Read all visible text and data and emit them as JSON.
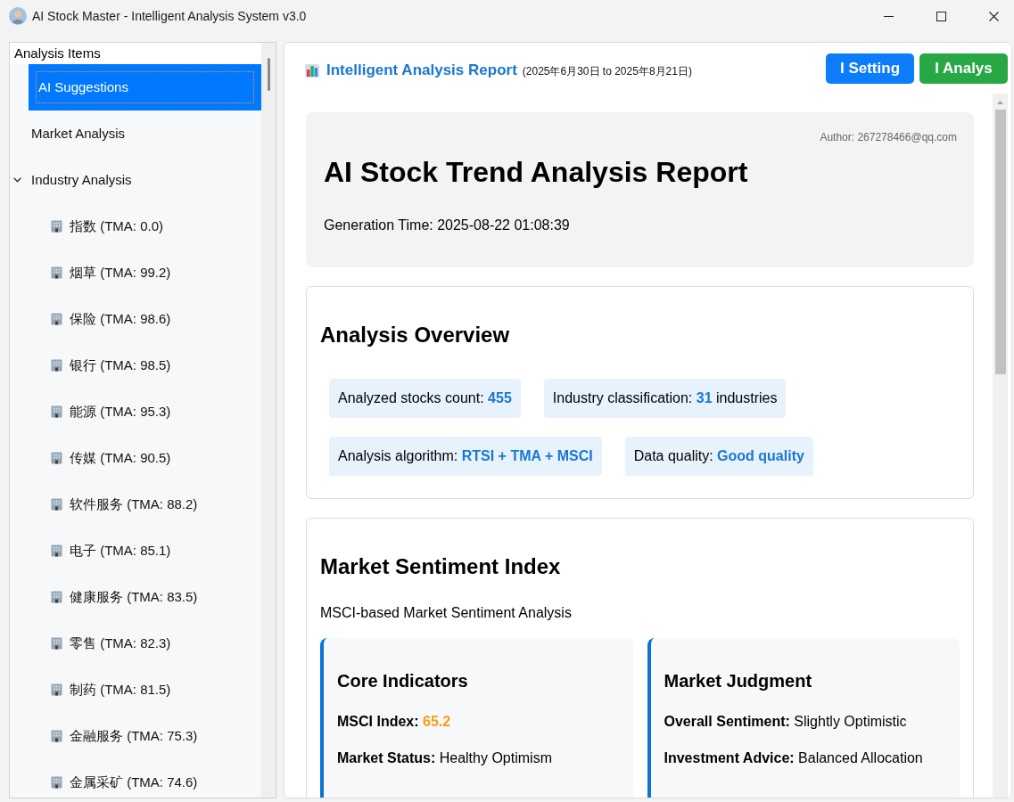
{
  "window": {
    "title": "AI Stock Master - Intelligent Analysis System v3.0"
  },
  "sidebar": {
    "header": "Analysis Items",
    "items": [
      {
        "label": "AI Suggestions",
        "selected": true
      },
      {
        "label": "Market Analysis",
        "selected": false
      },
      {
        "label": "Industry Analysis",
        "selected": false,
        "expanded": true,
        "children": [
          {
            "label": "指数 (TMA: 0.0)",
            "selected": false
          },
          {
            "label": "烟草 (TMA: 99.2)",
            "selected": false
          },
          {
            "label": "保险 (TMA: 98.6)",
            "selected": false
          },
          {
            "label": "银行 (TMA: 98.5)",
            "selected": false
          },
          {
            "label": "能源 (TMA: 95.3)",
            "selected": false
          },
          {
            "label": "传媒 (TMA: 90.5)",
            "selected": false
          },
          {
            "label": "软件服务 (TMA: 88.2)",
            "selected": false
          },
          {
            "label": "电子 (TMA: 85.1)",
            "selected": false
          },
          {
            "label": "健康服务 (TMA: 83.5)",
            "selected": false
          },
          {
            "label": "零售 (TMA: 82.3)",
            "selected": false
          },
          {
            "label": "制药 (TMA: 81.5)",
            "selected": false
          },
          {
            "label": "金融服务 (TMA: 75.3)",
            "selected": false
          },
          {
            "label": "金属采矿 (TMA: 74.6)",
            "selected": false
          }
        ]
      }
    ]
  },
  "report": {
    "title": "Intelligent Analysis Report",
    "date_range": "(2025年6月30日 to 2025年8月21日)",
    "buttons": [
      {
        "label": "I Setting",
        "kind": "primary"
      },
      {
        "label": "I Analys",
        "kind": "success"
      }
    ],
    "header_card": {
      "author": "Author: 267278466@qq.com",
      "title": "AI Stock Trend Analysis Report",
      "generation_time": "Generation Time: 2025-08-22 01:08:39"
    },
    "overview": {
      "heading": "Analysis Overview",
      "stats": [
        "Analyzed stocks count: **455**",
        "Industry classification: **31** industries",
        "Analysis algorithm: **RTSI + TMA + MSCI**",
        "Data quality: **Good quality**"
      ]
    },
    "sentiment": {
      "heading": "Market Sentiment Index",
      "subtitle": "MSCI-based Market Sentiment Analysis",
      "panels": [
        {
          "title": "Core Indicators",
          "lines": [
            {
              "label": "MSCI Index:",
              "value": "65.2",
              "kind": "score"
            },
            {
              "label": "Market Status:",
              "value": "Healthy Optimism",
              "kind": "text"
            }
          ]
        },
        {
          "title": "Market Judgment",
          "lines": [
            {
              "label": "Overall Sentiment:",
              "value": "Slightly Optimistic",
              "kind": "text"
            },
            {
              "label": "Investment Advice:",
              "value": "Balanced Allocation",
              "kind": "text"
            }
          ]
        }
      ]
    }
  }
}
